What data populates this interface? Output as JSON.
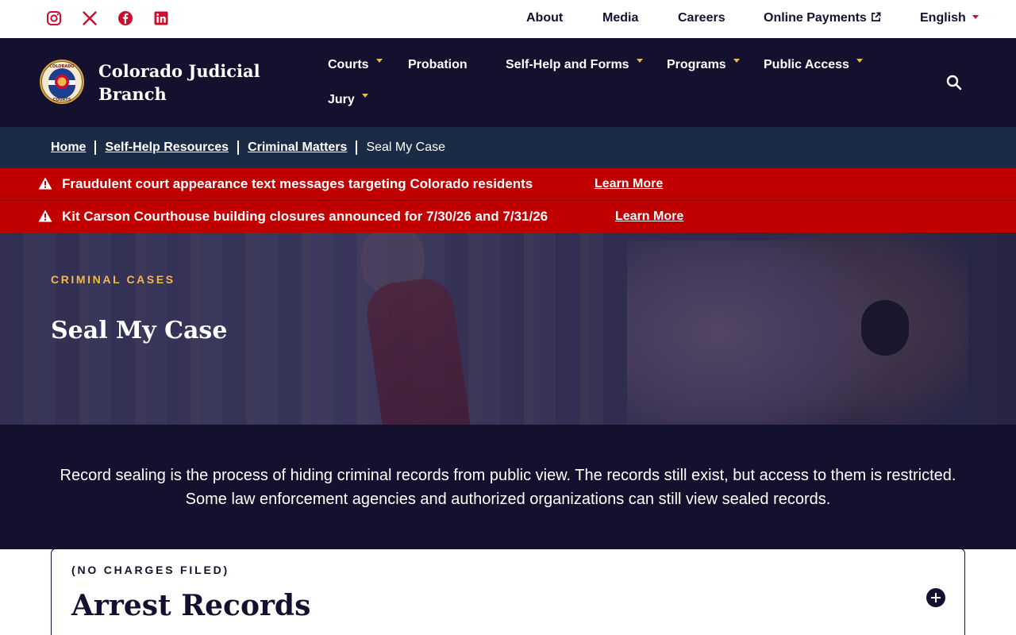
{
  "social": [
    {
      "name": "instagram-icon"
    },
    {
      "name": "x-icon"
    },
    {
      "name": "facebook-icon"
    },
    {
      "name": "linkedin-icon"
    }
  ],
  "utility": {
    "about": "About",
    "media": "Media",
    "careers": "Careers",
    "online_payments": "Online Payments",
    "language": "English"
  },
  "brand": {
    "name": "Colorado Judicial Branch",
    "seal_top": "COLORADO",
    "seal_bottom": "COURTS"
  },
  "nav": {
    "courts": "Courts",
    "probation": "Probation",
    "self_help": "Self-Help and Forms",
    "programs": "Programs",
    "public_access": "Public Access",
    "jury": "Jury"
  },
  "breadcrumb": {
    "home": "Home",
    "self_help": "Self-Help Resources",
    "criminal": "Criminal Matters",
    "current": "Seal My Case"
  },
  "alerts": [
    {
      "text": "Fraudulent court appearance text messages targeting Colorado residents",
      "link": "Learn More"
    },
    {
      "text": "Kit Carson Courthouse building closures announced for 7/30/26 and 7/31/26",
      "link": "Learn More"
    }
  ],
  "hero": {
    "eyebrow": "CRIMINAL CASES",
    "title": "Seal My Case"
  },
  "intro": {
    "text": "Record sealing is the process of hiding criminal records from public view. The records still exist, but access to them is restricted. Some law enforcement agencies and authorized organizations can still view sealed records."
  },
  "accordion": {
    "eyebrow": "(NO CHARGES FILED)",
    "title": "Arrest Records"
  },
  "colors": {
    "navy": "#14112e",
    "breadcrumb": "#1c2b45",
    "alert_red": "#c00000",
    "gold": "#f2b84b",
    "icon_red": "#c8102e"
  }
}
